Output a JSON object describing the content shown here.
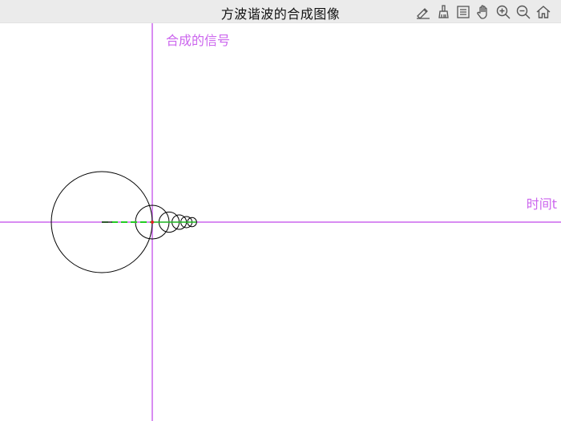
{
  "window": {
    "title": "方波谐波的合成图像"
  },
  "toolbar": {
    "tools": [
      {
        "name": "pen-eraser-icon"
      },
      {
        "name": "brush-icon"
      },
      {
        "name": "menu-list-icon"
      },
      {
        "name": "hand-pan-icon"
      },
      {
        "name": "zoom-in-icon"
      },
      {
        "name": "zoom-out-icon"
      },
      {
        "name": "home-icon"
      }
    ]
  },
  "graph": {
    "y_axis_label": "合成的信号",
    "x_axis_label": "时间t",
    "colors": {
      "axis": "#cc66ee",
      "circles": "#000000",
      "radius_lines": "#22cc22",
      "point": "#dd2222"
    }
  }
}
